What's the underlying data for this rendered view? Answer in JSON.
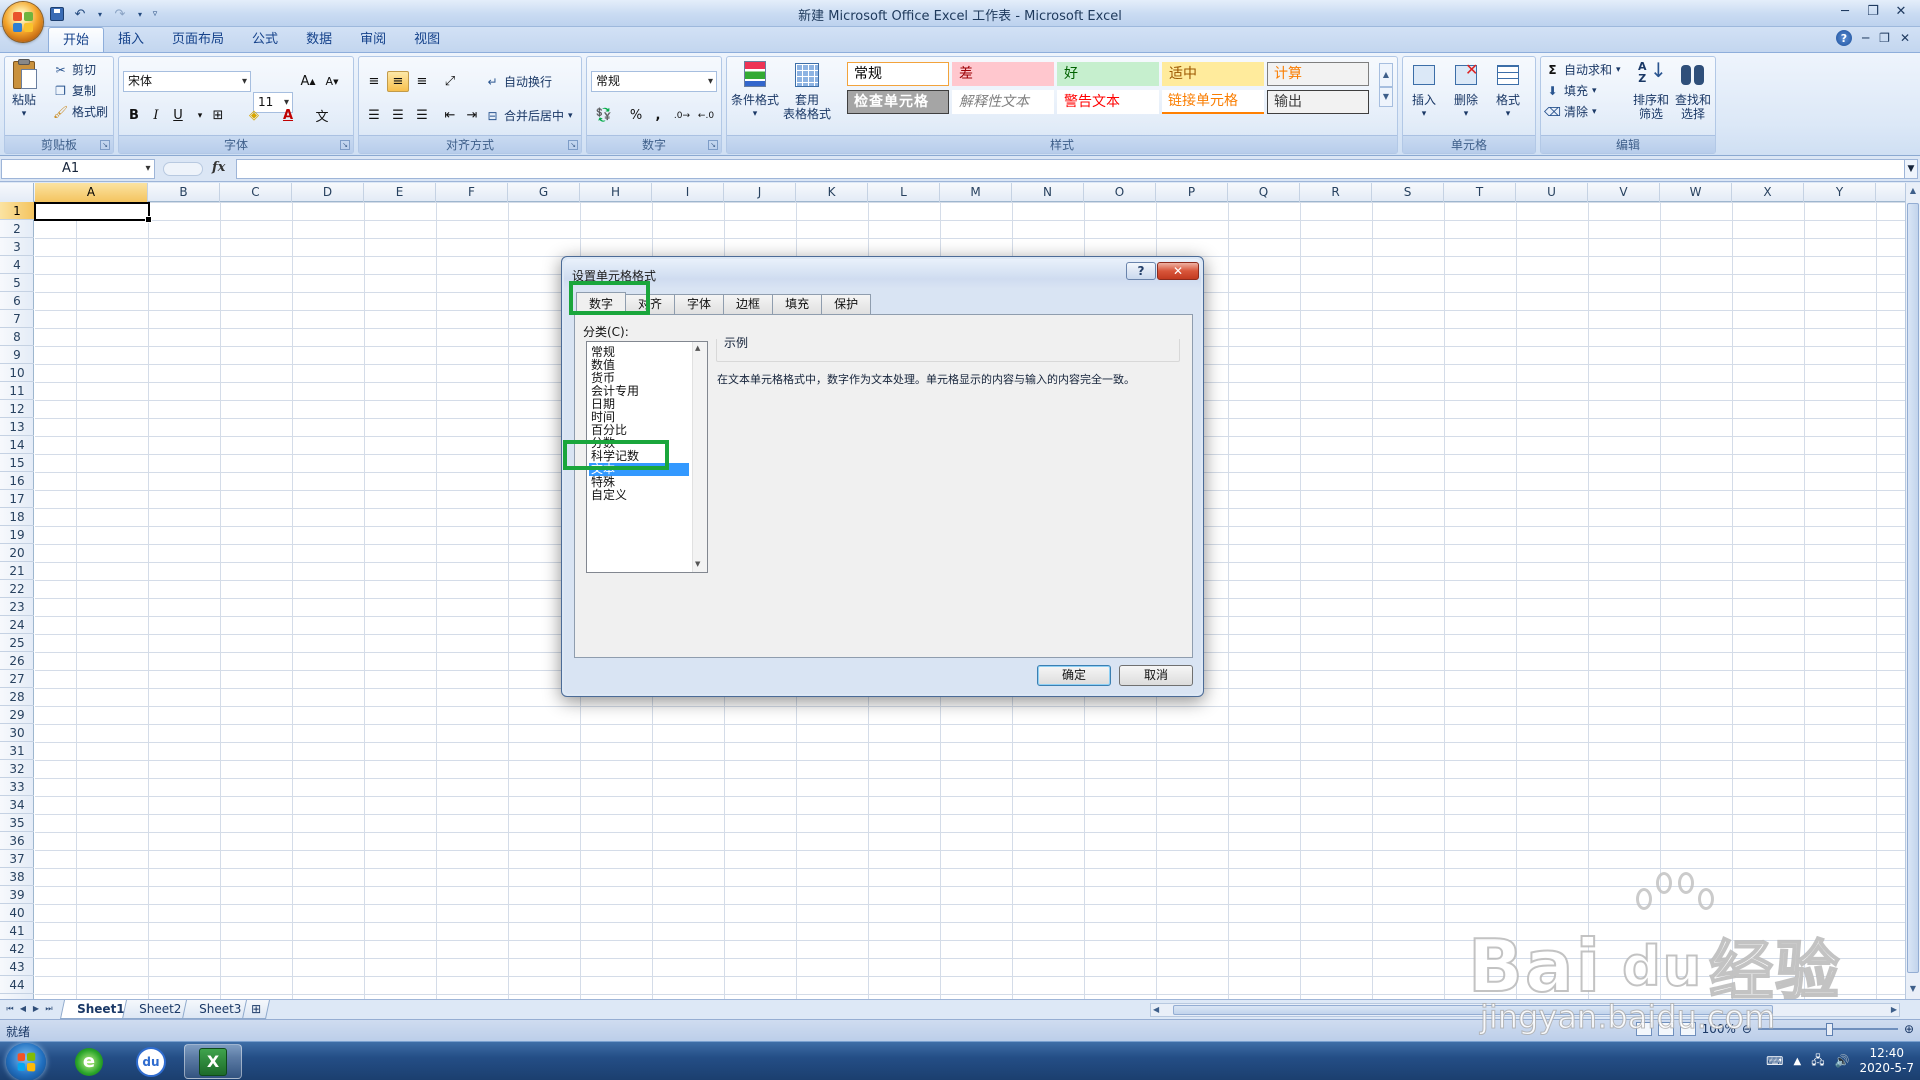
{
  "window": {
    "title": "新建 Microsoft Office Excel 工作表 - Microsoft Excel",
    "controls": [
      "─",
      "❐",
      "✕"
    ]
  },
  "ribbon_tabs": [
    "开始",
    "插入",
    "页面布局",
    "公式",
    "数据",
    "审阅",
    "视图"
  ],
  "ribbon_right": [
    "?",
    "─",
    "❐",
    "✕"
  ],
  "ribbon": {
    "clipboard": {
      "title": "剪贴板",
      "paste": "粘贴",
      "cut": "剪切",
      "copy": "复制",
      "format_painter": "格式刷"
    },
    "font": {
      "title": "字体",
      "font_name": "宋体",
      "font_size": "11",
      "bold": "B",
      "italic": "I",
      "underline": "U"
    },
    "alignment": {
      "title": "对齐方式",
      "wrap": "自动换行",
      "merge": "合并后居中"
    },
    "number": {
      "title": "数字",
      "format": "常规",
      "percent": "%",
      "comma": ","
    },
    "styles": {
      "title": "样式",
      "conditional": "条件格式",
      "table_line1": "套用",
      "table_line2": "表格格式",
      "cells": [
        {
          "label": "常规",
          "bg": "#ffffff",
          "color": "#000000",
          "border": "#f2a33c"
        },
        {
          "label": "差",
          "bg": "#ffc7ce",
          "color": "#9c0006",
          "border": "#ffc7ce"
        },
        {
          "label": "好",
          "bg": "#c6efce",
          "color": "#006100",
          "border": "#c6efce"
        },
        {
          "label": "适中",
          "bg": "#ffeb9c",
          "color": "#9c5700",
          "border": "#ffeb9c"
        },
        {
          "label": "计算",
          "bg": "#f2f2f2",
          "color": "#fa7d00",
          "border": "#7f7f7f"
        },
        {
          "label": "检查单元格",
          "bg": "#a5a5a5",
          "color": "#ffffff",
          "border": "#3f3f3f"
        },
        {
          "label": "解释性文本",
          "bg": "#ffffff",
          "color": "#7f7f7f",
          "border": "#ffffff"
        },
        {
          "label": "警告文本",
          "bg": "#ffffff",
          "color": "#ff0000",
          "border": "#ffffff"
        },
        {
          "label": "链接单元格",
          "bg": "#ffffff",
          "color": "#fa7d00",
          "border": "#ff8001"
        },
        {
          "label": "输出",
          "bg": "#f2f2f2",
          "color": "#3f3f3f",
          "border": "#3f3f3f"
        }
      ]
    },
    "cells_group": {
      "title": "单元格",
      "insert": "插入",
      "delete": "删除",
      "format": "格式"
    },
    "editing": {
      "title": "编辑",
      "autosum": "自动求和",
      "fill": "填充",
      "clear": "清除",
      "sort_line1": "排序和",
      "sort_line2": "筛选",
      "find_line1": "查找和",
      "find_line2": "选择"
    }
  },
  "formula_bar": {
    "name_box": "A1",
    "fx": "fx",
    "value": ""
  },
  "columns": [
    "A",
    "B",
    "C",
    "D",
    "E",
    "F",
    "G",
    "H",
    "I",
    "J",
    "K",
    "L",
    "M",
    "N",
    "O",
    "P",
    "Q",
    "R",
    "S",
    "T",
    "U",
    "V",
    "W",
    "X",
    "Y"
  ],
  "rows": [
    "1",
    "2",
    "3",
    "4",
    "5",
    "6",
    "7",
    "8",
    "9",
    "10",
    "11",
    "12",
    "13",
    "14",
    "15",
    "16",
    "17",
    "18",
    "19",
    "20",
    "21",
    "22",
    "23",
    "24",
    "25",
    "26",
    "27",
    "28",
    "29",
    "30",
    "31",
    "32",
    "33",
    "34",
    "35",
    "36",
    "37",
    "38",
    "39",
    "40",
    "41",
    "42",
    "43",
    "44"
  ],
  "sheets": [
    "Sheet1",
    "Sheet2",
    "Sheet3"
  ],
  "status": {
    "text": "就绪",
    "zoom": "100%"
  },
  "taskbar": {
    "time": "12:40",
    "date": "2020-5-7"
  },
  "dialog": {
    "title": "设置单元格格式",
    "help": "?",
    "close": "✕",
    "tabs": [
      "数字",
      "对齐",
      "字体",
      "边框",
      "填充",
      "保护"
    ],
    "active_tab": "数字",
    "category_label": "分类(C):",
    "categories": [
      "常规",
      "数值",
      "货币",
      "会计专用",
      "日期",
      "时间",
      "百分比",
      "分数",
      "科学记数",
      "文本",
      "特殊",
      "自定义"
    ],
    "selected_category": "文本",
    "sample_label": "示例",
    "description": "在文本单元格格式中，数字作为文本处理。单元格显示的内容与输入的内容完全一致。",
    "ok": "确定",
    "cancel": "取消"
  },
  "watermark": {
    "line1": "Bai",
    "line1b": "du",
    "line1c": "经验",
    "line2": "jingyan.baidu.com"
  }
}
